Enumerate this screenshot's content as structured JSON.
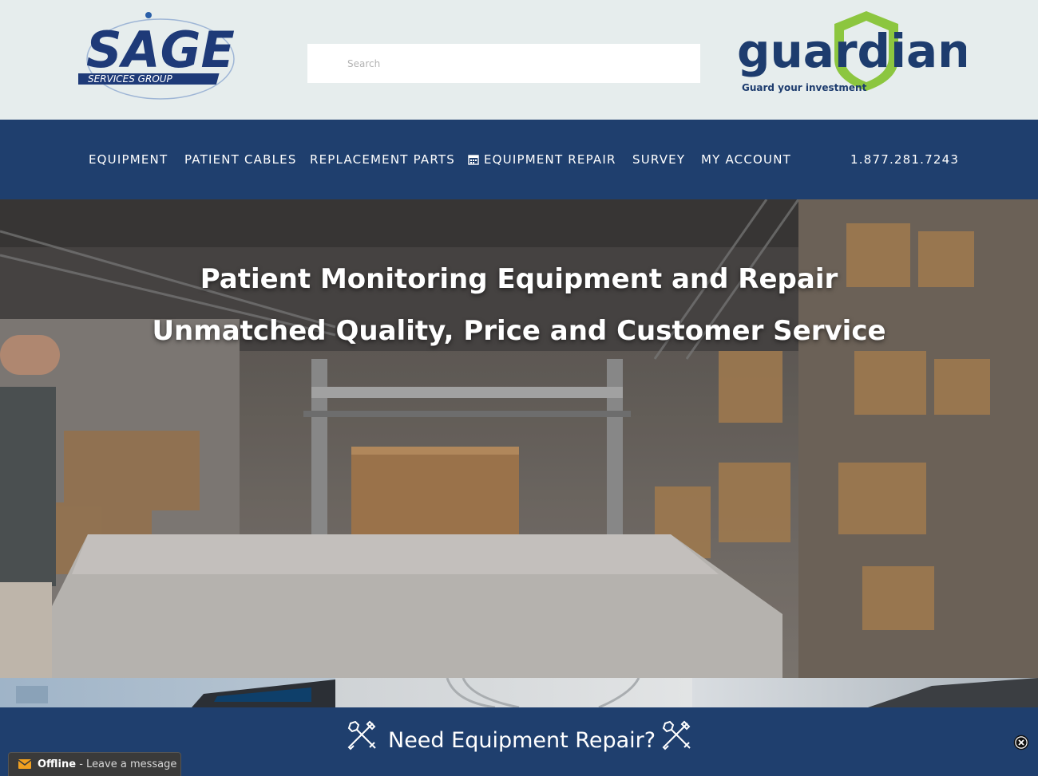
{
  "header": {
    "logo_left": {
      "main": "SAGE",
      "sub": "SERVICES GROUP"
    },
    "search_placeholder": "Search",
    "logo_right": {
      "main": "guardian",
      "tagline": "Guard your investment"
    }
  },
  "nav": {
    "items": [
      {
        "label": "EQUIPMENT"
      },
      {
        "label": "PATIENT CABLES"
      },
      {
        "label": "REPLACEMENT PARTS"
      },
      {
        "label": "EQUIPMENT REPAIR",
        "icon": "calendar-icon"
      },
      {
        "label": "SURVEY"
      },
      {
        "label": "MY ACCOUNT"
      }
    ],
    "phone": "1.877.281.7243"
  },
  "hero": {
    "title": "Patient Monitoring Equipment and Repair",
    "subtitle": "Unmatched Quality, Price and Customer Service"
  },
  "repair_bar": {
    "text": "Need Equipment Repair?",
    "icons": [
      "wrench-screwdriver-icon",
      "wrench-screwdriver-icon",
      "close-circle-icon"
    ]
  },
  "chat": {
    "status": "Offline",
    "message": " - Leave a message",
    "icon": "mail-icon"
  },
  "colors": {
    "nav_bg": "#1f3f6e",
    "header_bg": "#e6eded",
    "sage_blue": "#1e3a78",
    "guardian_green": "#8cc63f",
    "guardian_navy": "#1d3c6e"
  }
}
